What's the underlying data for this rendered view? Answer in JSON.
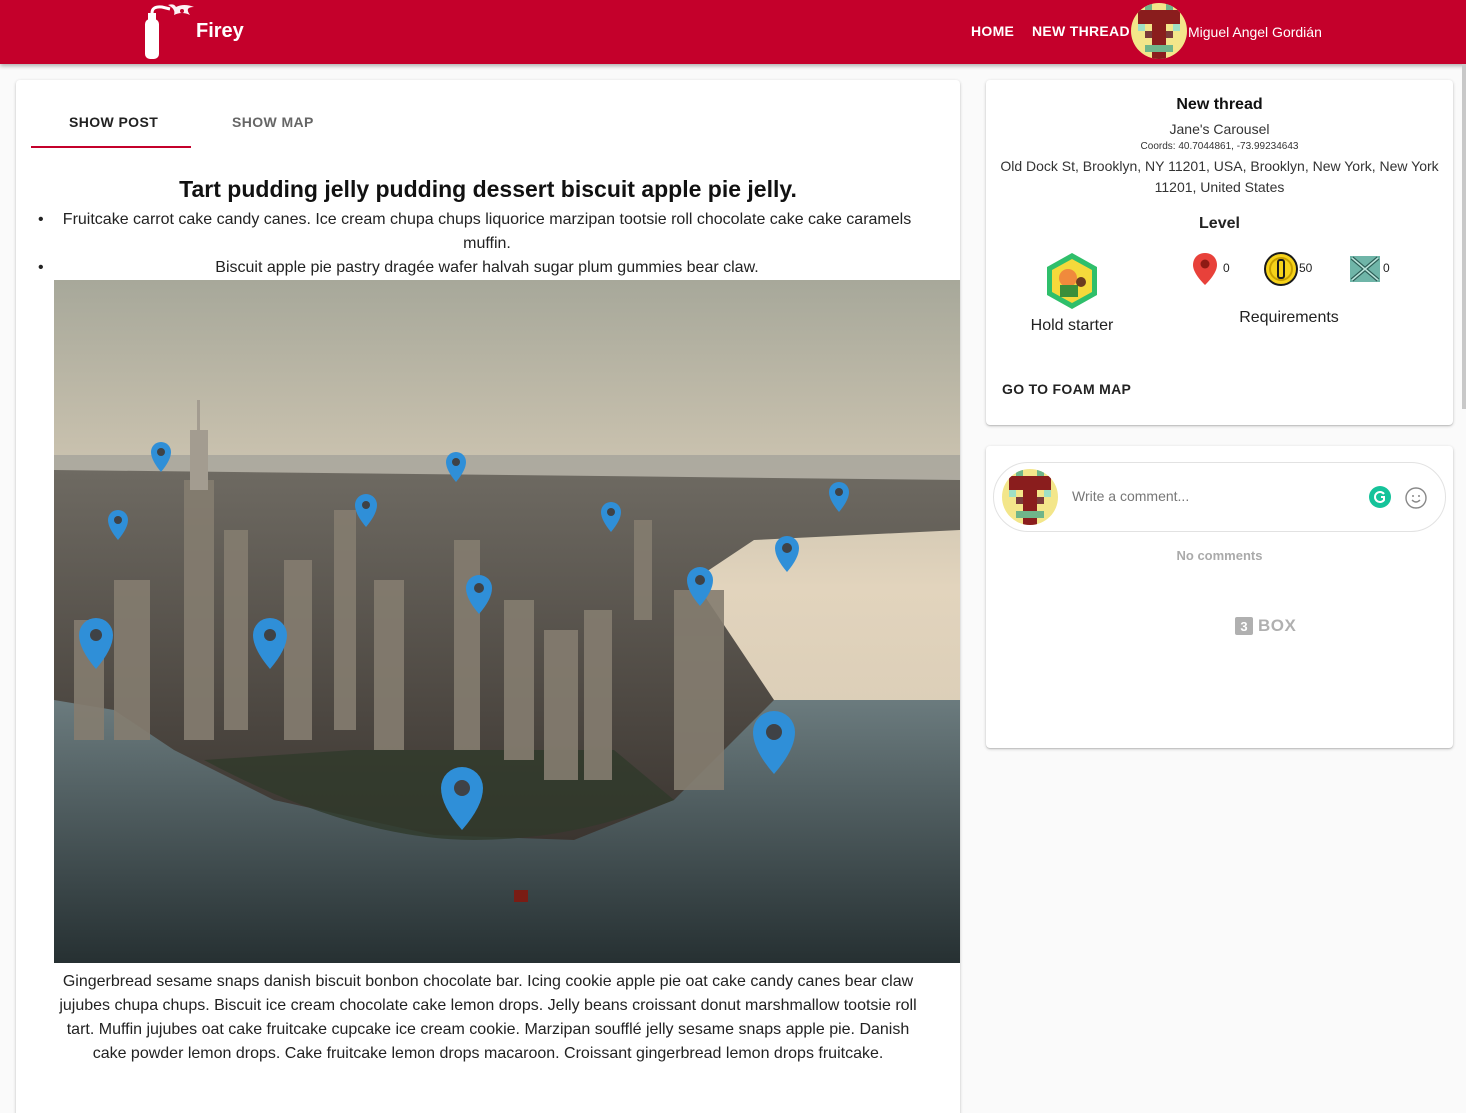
{
  "app": {
    "title": "Firey"
  },
  "nav": {
    "home": "HOME",
    "new_thread": "NEW THREAD",
    "user_name": "Miguel Angel Gordián"
  },
  "tabs": [
    {
      "label": "SHOW POST",
      "active": true
    },
    {
      "label": "SHOW MAP",
      "active": false
    }
  ],
  "post": {
    "title": "Tart pudding jelly pudding dessert biscuit apple pie jelly.",
    "bullets": [
      "Fruitcake carrot cake candy canes. Ice cream chupa chups liquorice marzipan tootsie roll chocolate cake cake caramels muffin.",
      "Biscuit apple pie pastry dragée wafer halvah sugar plum gummies bear claw."
    ],
    "body": "Gingerbread sesame snaps danish biscuit bonbon chocolate bar. Icing cookie apple pie oat cake candy canes bear claw jujubes chupa chups. Biscuit ice cream chocolate cake lemon drops. Jelly beans croissant donut marshmallow tootsie roll tart. Muffin jujubes oat cake fruitcake cupcake ice cream cookie. Marzipan soufflé jelly sesame snaps apple pie. Danish cake powder lemon drops. Cake fruitcake lemon drops macaroon. Croissant gingerbread lemon drops fruitcake."
  },
  "thread_info": {
    "title": "New thread",
    "place_name": "Jane's Carousel",
    "coords": "Coords: 40.7044861, -73.99234643",
    "address": "Old Dock St, Brooklyn, NY 11201, USA, Brooklyn, New York, New York 11201, United States",
    "level_title": "Level",
    "badge_label": "Hold starter",
    "requirements": {
      "pins": "0",
      "coins": "50",
      "swords": "0",
      "label": "Requirements"
    },
    "foam_button": "GO TO FOAM MAP"
  },
  "comments": {
    "placeholder": "Write a comment...",
    "empty_text": "No comments",
    "box_number": "3",
    "box_text": "BOX"
  },
  "colors": {
    "primary": "#c4002b",
    "pin_blue": "#2f8fd8",
    "grammarly": "#15c39a"
  },
  "icons": [
    "fire-extinguisher-icon",
    "pixel-avatar-icon",
    "map-pin-icon",
    "gold-coin-icon",
    "crossed-swords-icon",
    "grammarly-icon",
    "smile-icon"
  ]
}
